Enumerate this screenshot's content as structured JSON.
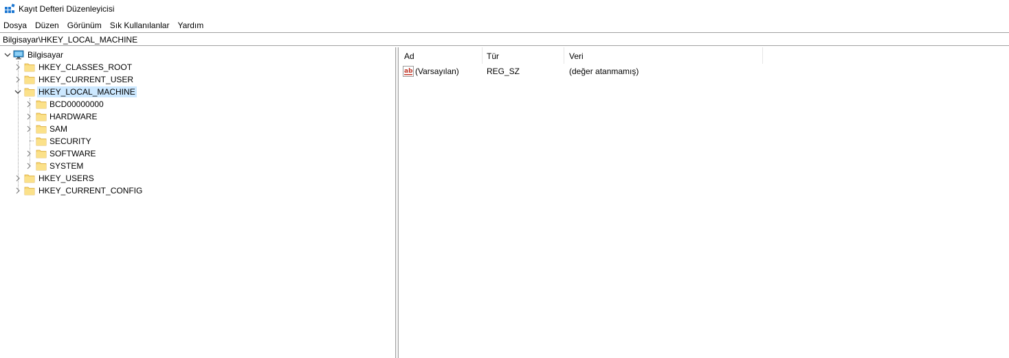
{
  "window": {
    "title": "Kayıt Defteri Düzenleyicisi",
    "icon": "registry-editor-icon"
  },
  "menu": {
    "items": [
      "Dosya",
      "Düzen",
      "Görünüm",
      "Sık Kullanılanlar",
      "Yardım"
    ]
  },
  "address": {
    "path": "Bilgisayar\\HKEY_LOCAL_MACHINE"
  },
  "tree": {
    "root": "Bilgisayar",
    "hives": [
      "HKEY_CLASSES_ROOT",
      "HKEY_CURRENT_USER",
      "HKEY_LOCAL_MACHINE",
      "HKEY_USERS",
      "HKEY_CURRENT_CONFIG"
    ],
    "selected": "HKEY_LOCAL_MACHINE",
    "hklm_children": [
      "BCD00000000",
      "HARDWARE",
      "SAM",
      "SECURITY",
      "SOFTWARE",
      "SYSTEM"
    ]
  },
  "list": {
    "columns": [
      "Ad",
      "Tür",
      "Veri"
    ],
    "rows": [
      {
        "name": "(Varsayılan)",
        "type": "REG_SZ",
        "data": "(değer atanmamış)",
        "icon": "string-value-icon"
      }
    ]
  },
  "colors": {
    "selection": "#cce8ff",
    "folder": "#f7d774",
    "folder_dark": "#e8b94a",
    "border": "#a0a0a0"
  }
}
